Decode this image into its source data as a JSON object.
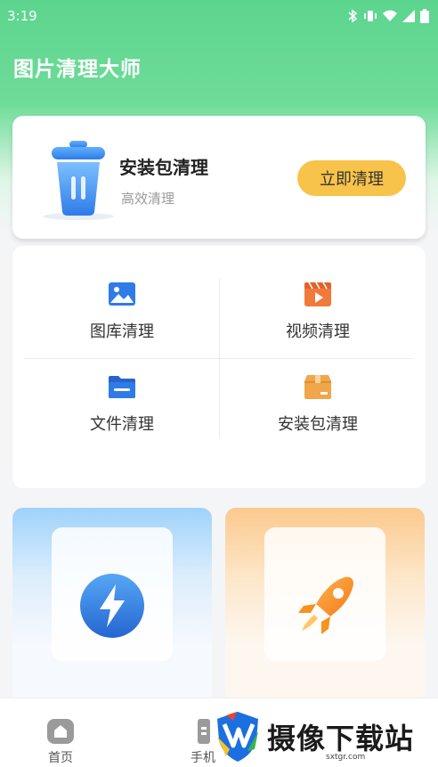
{
  "status_bar": {
    "time": "3:19"
  },
  "app": {
    "title": "图片清理大师"
  },
  "main_card": {
    "title": "安装包清理",
    "subtitle": "高效清理",
    "button_label": "立即清理"
  },
  "grid": {
    "items": [
      {
        "label": "图库清理",
        "icon": "gallery-icon"
      },
      {
        "label": "视频清理",
        "icon": "video-icon"
      },
      {
        "label": "文件清理",
        "icon": "folder-icon"
      },
      {
        "label": "安装包清理",
        "icon": "package-icon"
      }
    ]
  },
  "features": [
    {
      "icon": "lightning-icon"
    },
    {
      "icon": "rocket-icon"
    }
  ],
  "bottom_nav": {
    "items": [
      {
        "label": "首页",
        "icon": "home-icon"
      },
      {
        "label": "手机",
        "icon": "phone-icon"
      }
    ]
  },
  "watermark": {
    "text": "摄像下载站",
    "url": "sxtgr.com"
  },
  "colors": {
    "header_green": "#5cd58f",
    "button_yellow": "#f8c34a",
    "icon_blue": "#2f7be8",
    "icon_orange": "#f07a3a"
  }
}
